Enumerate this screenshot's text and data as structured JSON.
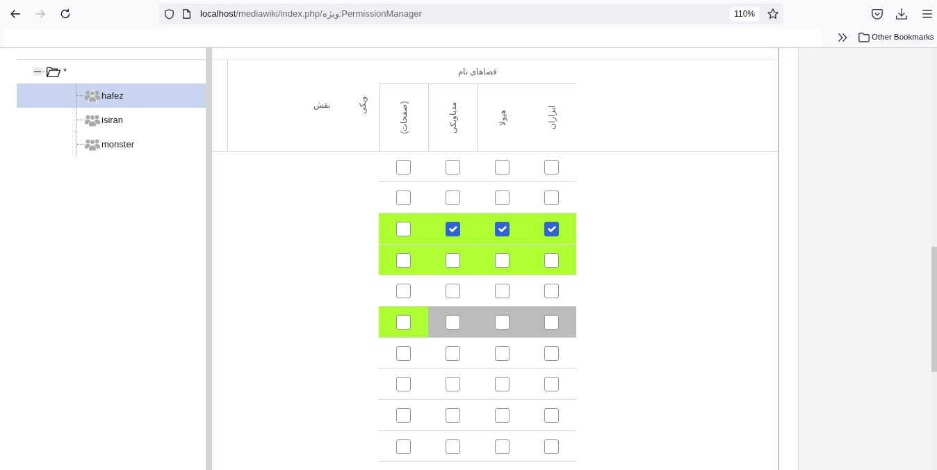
{
  "browser": {
    "nav": [
      {
        "kind": "back",
        "disabled": false
      },
      {
        "kind": "forward",
        "disabled": true
      },
      {
        "kind": "reload",
        "disabled": false
      }
    ],
    "url": {
      "host": "localhost",
      "path": "/mediawiki/index.php/ویژه:PermissionManager"
    },
    "zoom": "110%",
    "bookmarks": [
      {
        "label": "Other Bookmarks"
      }
    ]
  },
  "tree": {
    "nodes": [
      {
        "label": "*",
        "expanded": true,
        "selected": false,
        "children": [
          {
            "label": "hafez",
            "selected": true
          },
          {
            "label": "isiran",
            "selected": false
          },
          {
            "label": "monster",
            "selected": false
          }
        ]
      }
    ]
  },
  "table": {
    "namespace_group": {
      "label": "فضاهای نام",
      "columns": [
        {
          "label": "ابزاران"
        },
        {
          "label": "هیولا"
        },
        {
          "label": "مدیاویکی"
        },
        {
          "label": "(صفحات)"
        }
      ]
    },
    "columns": [
      {
        "label": "ویکی"
      },
      {
        "label": "نقش"
      }
    ],
    "rows": [
      {
        "cells": [
          {
            "checked": false
          },
          {
            "checked": false
          },
          {
            "checked": false
          },
          {
            "checked": false
          }
        ]
      },
      {
        "cells": [
          {
            "checked": false
          },
          {
            "checked": false
          },
          {
            "checked": false
          },
          {
            "checked": false
          }
        ]
      },
      {
        "cells": [
          {
            "checked": true,
            "color": "#adff2f"
          },
          {
            "checked": true,
            "color": "#adff2f"
          },
          {
            "checked": true,
            "color": "#adff2f"
          },
          {
            "checked": false,
            "color": "#adff2f"
          }
        ]
      },
      {
        "cells": [
          {
            "checked": false,
            "color": "#adff2f"
          },
          {
            "checked": false,
            "color": "#adff2f"
          },
          {
            "checked": false,
            "color": "#adff2f"
          },
          {
            "checked": false,
            "color": "#adff2f"
          }
        ]
      },
      {
        "cells": [
          {
            "checked": false
          },
          {
            "checked": false
          },
          {
            "checked": false
          },
          {
            "checked": false
          }
        ]
      },
      {
        "cells": [
          {
            "checked": false,
            "color": "#bbbbbb"
          },
          {
            "checked": false,
            "color": "#bbbbbb"
          },
          {
            "checked": false,
            "color": "#bbbbbb"
          },
          {
            "checked": false,
            "color": "#adff2f"
          }
        ]
      },
      {
        "cells": [
          {
            "checked": false
          },
          {
            "checked": false
          },
          {
            "checked": false
          },
          {
            "checked": false
          }
        ]
      },
      {
        "cells": [
          {
            "checked": false
          },
          {
            "checked": false
          },
          {
            "checked": false
          },
          {
            "checked": false
          }
        ]
      },
      {
        "cells": [
          {
            "checked": false
          },
          {
            "checked": false
          },
          {
            "checked": false
          },
          {
            "checked": false
          }
        ]
      },
      {
        "cells": [
          {
            "checked": false
          },
          {
            "checked": false
          },
          {
            "checked": false
          },
          {
            "checked": false
          }
        ]
      }
    ]
  }
}
